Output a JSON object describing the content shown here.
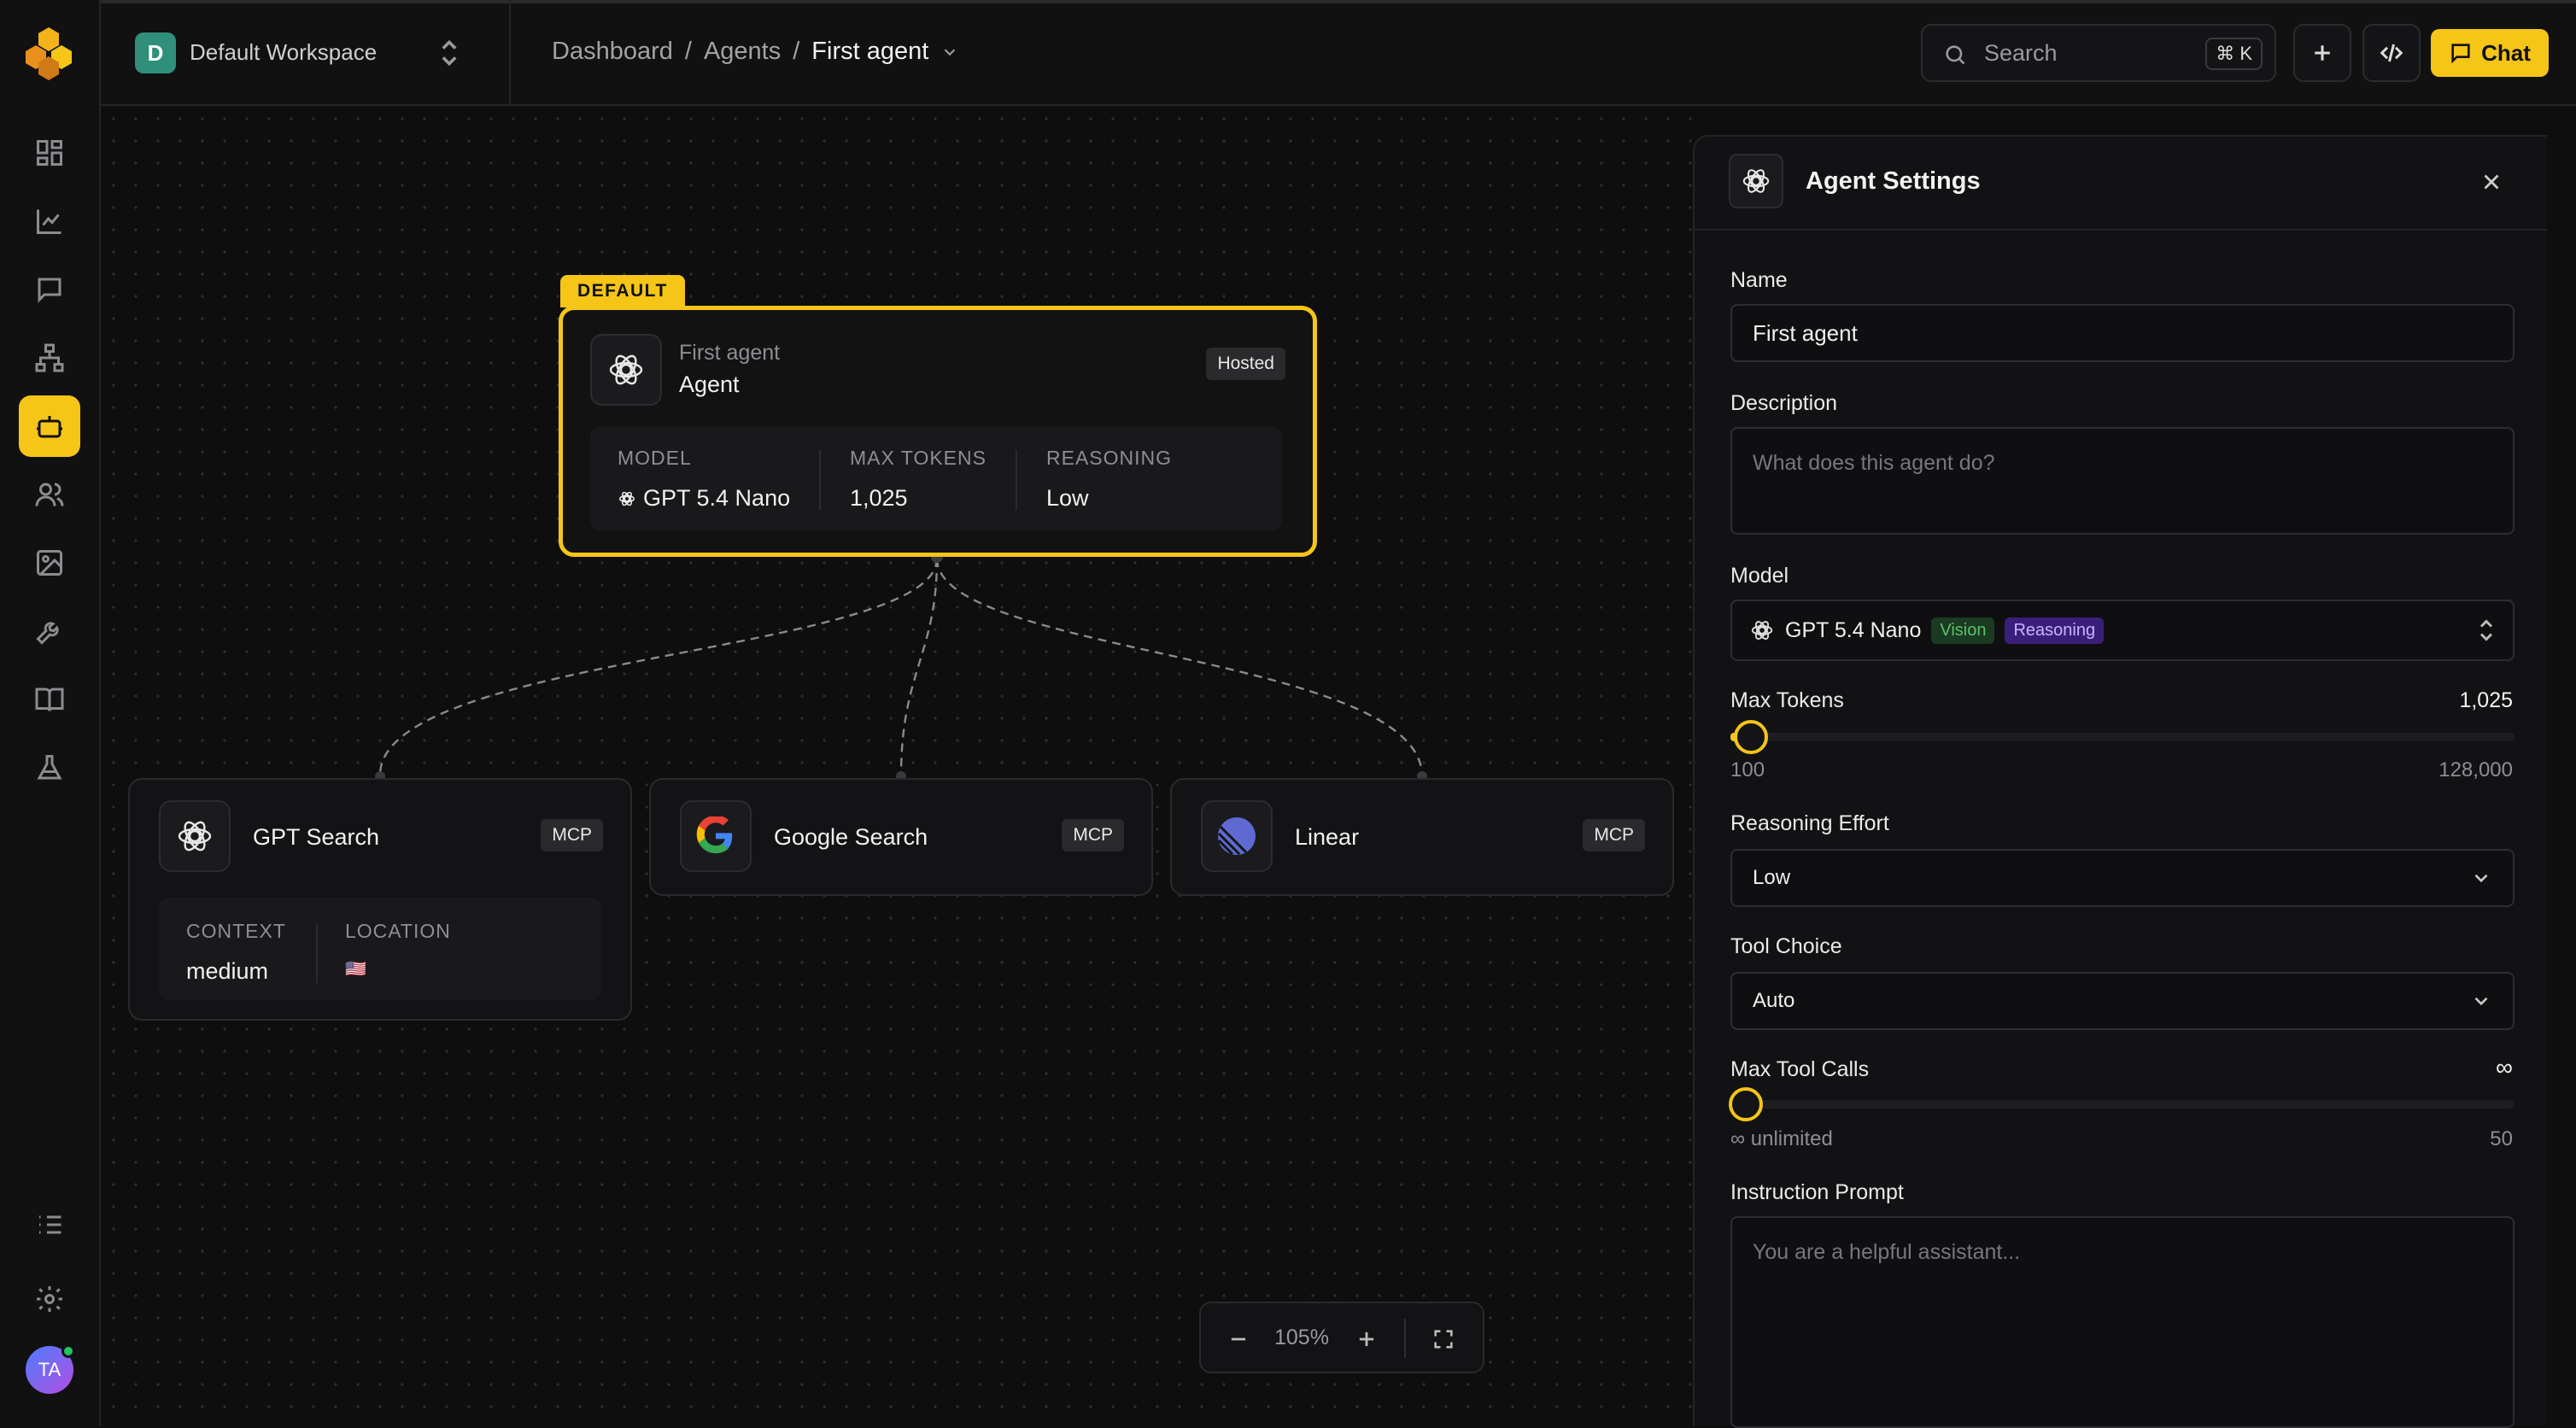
{
  "workspace": {
    "initial": "D",
    "name": "Default Workspace"
  },
  "breadcrumb": {
    "items": [
      "Dashboard",
      "Agents"
    ],
    "current": "First agent",
    "separator": "/"
  },
  "search": {
    "placeholder": "Search",
    "shortcut": "⌘ K"
  },
  "chat_button": {
    "label": "Chat"
  },
  "user": {
    "initials": "TA"
  },
  "agent_node": {
    "tag": "DEFAULT",
    "name": "First agent",
    "type": "Agent",
    "badge": "Hosted",
    "stats": [
      {
        "label": "MODEL",
        "value": "GPT 5.4 Nano"
      },
      {
        "label": "MAX TOKENS",
        "value": "1,025"
      },
      {
        "label": "REASONING",
        "value": "Low"
      }
    ]
  },
  "tool_nodes": [
    {
      "name": "GPT Search",
      "badge": "MCP",
      "icon": "openai-icon",
      "stats": [
        {
          "label": "CONTEXT",
          "value": "medium"
        },
        {
          "label": "LOCATION",
          "value": "🇺🇸"
        }
      ]
    },
    {
      "name": "Google Search",
      "badge": "MCP",
      "icon": "google-icon"
    },
    {
      "name": "Linear",
      "badge": "MCP",
      "icon": "linear-icon"
    }
  ],
  "zoom": {
    "level": "105%"
  },
  "panel": {
    "title": "Agent Settings",
    "name_label": "Name",
    "name_value": "First agent",
    "description_label": "Description",
    "description_placeholder": "What does this agent do?",
    "model_label": "Model",
    "model_value": "GPT 5.4 Nano",
    "model_tags": [
      "Vision",
      "Reasoning"
    ],
    "max_tokens_label": "Max Tokens",
    "max_tokens_value": "1,025",
    "max_tokens_min": "100",
    "max_tokens_max": "128,000",
    "max_tokens_fraction": 0.007,
    "reasoning_label": "Reasoning Effort",
    "reasoning_value": "Low",
    "tool_choice_label": "Tool Choice",
    "tool_choice_value": "Auto",
    "max_tool_calls_label": "Max Tool Calls",
    "max_tool_calls_value": "∞",
    "max_tool_calls_min": "∞ unlimited",
    "max_tool_calls_max": "50",
    "instruction_label": "Instruction Prompt",
    "instruction_placeholder": "You are a helpful assistant..."
  },
  "colors": {
    "accent": "#f5c518",
    "vision_tag": "#4caf50",
    "reasoning_tag": "#7c4dff"
  }
}
